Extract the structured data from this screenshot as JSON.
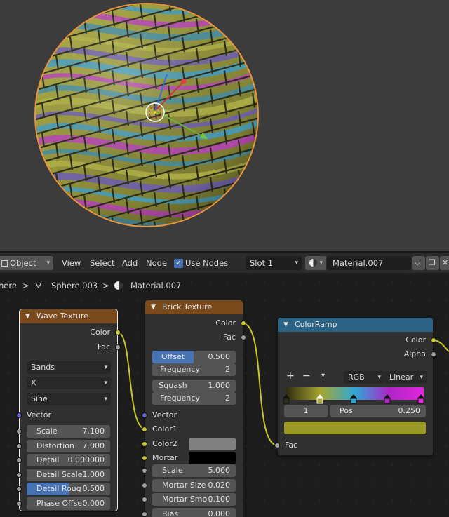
{
  "header": {
    "mode": "Object",
    "menus": [
      "View",
      "Select",
      "Add",
      "Node"
    ],
    "use_nodes_label": "Use Nodes",
    "use_nodes_checked": true,
    "slot": "Slot 1",
    "material": "Material.007"
  },
  "breadcrumb": {
    "items": [
      "here",
      "Sphere.003",
      "Material.007"
    ]
  },
  "nodes": {
    "wave": {
      "title": "Wave Texture",
      "out_color": "Color",
      "out_fac": "Fac",
      "type": "Bands",
      "direction": "X",
      "profile": "Sine",
      "in_vector": "Vector",
      "fields": [
        {
          "label": "Scale",
          "value": "7.100"
        },
        {
          "label": "Distortion",
          "value": "7.000"
        },
        {
          "label": "Detail",
          "value": "0.000000"
        },
        {
          "label": "Detail Scale",
          "value": "1.000"
        },
        {
          "label": "Detail Roug",
          "value": "0.500",
          "fill": 0.5
        },
        {
          "label": "Phase Offse",
          "value": "0.000"
        }
      ]
    },
    "brick": {
      "title": "Brick Texture",
      "out_color": "Color",
      "out_fac": "Fac",
      "offset": {
        "label": "Offset",
        "value": "0.500",
        "fill": 0.5
      },
      "frequency1": {
        "label": "Frequency",
        "value": "2"
      },
      "squash": {
        "label": "Squash",
        "value": "1.000"
      },
      "frequency2": {
        "label": "Frequency",
        "value": "2"
      },
      "in_vector": "Vector",
      "in_color1": "Color1",
      "in_color2": "Color2",
      "in_mortar": "Mortar",
      "color2_hex": "#808080",
      "mortar_hex": "#000000",
      "fields": [
        {
          "label": "Scale",
          "value": "5.000"
        },
        {
          "label": "Mortar Size",
          "value": "0.020"
        },
        {
          "label": "Mortar Smo",
          "value": "0.100"
        },
        {
          "label": "Bias",
          "value": "0.000"
        }
      ]
    },
    "ramp": {
      "title": "ColorRamp",
      "out_color": "Color",
      "out_alpha": "Alpha",
      "btn_add": "+",
      "btn_remove": "−",
      "color_mode": "RGB",
      "interpolation": "Linear",
      "stop_index": "1",
      "pos_label": "Pos",
      "pos_value": "0.250",
      "active_color": "#9a9a24",
      "in_fac": "Fac",
      "stops": [
        {
          "pos": 0.0,
          "color": "#2e2e10"
        },
        {
          "pos": 0.25,
          "color": "#a6a630"
        },
        {
          "pos": 0.5,
          "color": "#2ea8d8"
        },
        {
          "pos": 0.75,
          "color": "#b024c4"
        },
        {
          "pos": 1.0,
          "color": "#e028e0"
        }
      ]
    }
  },
  "colors": {
    "viewport_bg": "#3c3c3c",
    "selection_outline": "#e9943a",
    "accent": "#4772b3",
    "texture_header": "#7b4a1c",
    "converter_header": "#2c6384",
    "color_socket": "#c7c729",
    "float_socket": "#a1a1a1",
    "vector_socket": "#6363c7"
  }
}
